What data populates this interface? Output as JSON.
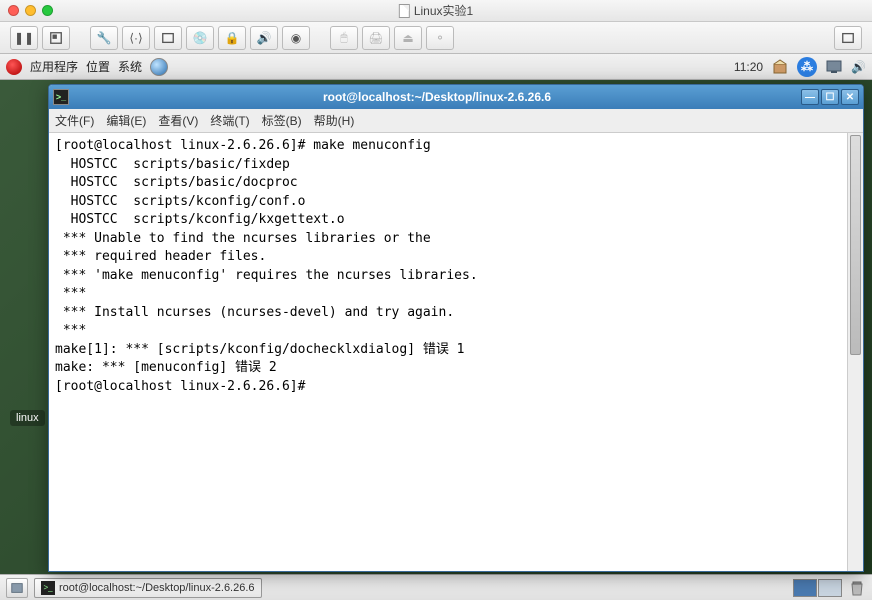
{
  "host_window": {
    "title": "Linux实验1"
  },
  "gnome_top": {
    "apps": "应用程序",
    "places": "位置",
    "system": "系统",
    "clock": "11:20"
  },
  "desktop": {
    "dock_label": "linux"
  },
  "terminal": {
    "title": "root@localhost:~/Desktop/linux-2.6.26.6",
    "menu": {
      "file": "文件(F)",
      "edit": "编辑(E)",
      "view": "查看(V)",
      "terminal": "终端(T)",
      "tabs": "标签(B)",
      "help": "帮助(H)"
    },
    "lines": [
      "[root@localhost linux-2.6.26.6]# make menuconfig",
      "  HOSTCC  scripts/basic/fixdep",
      "  HOSTCC  scripts/basic/docproc",
      "  HOSTCC  scripts/kconfig/conf.o",
      "  HOSTCC  scripts/kconfig/kxgettext.o",
      " *** Unable to find the ncurses libraries or the",
      " *** required header files.",
      " *** 'make menuconfig' requires the ncurses libraries.",
      " *** ",
      " *** Install ncurses (ncurses-devel) and try again.",
      " *** ",
      "make[1]: *** [scripts/kconfig/dochecklxdialog] 错误 1",
      "make: *** [menuconfig] 错误 2",
      "[root@localhost linux-2.6.26.6]# "
    ]
  },
  "bottom_panel": {
    "task_label": "root@localhost:~/Desktop/linux-2.6.26.6"
  }
}
